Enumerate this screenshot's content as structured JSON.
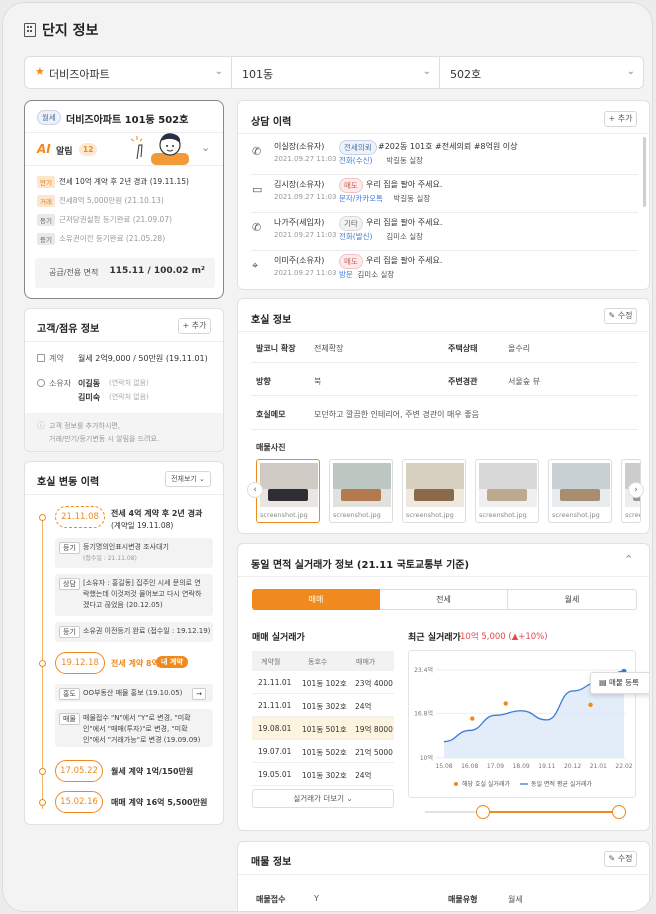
{
  "title": "단지 정보",
  "selects": {
    "apt": "더비즈아파트",
    "dong": "101동",
    "ho": "502호"
  },
  "unit_card": {
    "badge": "월세",
    "name": "더비즈아파트 101동 502호",
    "ai_label": "알림",
    "ai_count": "12",
    "alerts": [
      {
        "tag": "만기",
        "text": "전세 10억 계약 후 2년 경과 (19.11.15)"
      },
      {
        "tag": "거래",
        "text": "전세8억 5,000만원 (21.10.13)"
      },
      {
        "tag": "등기",
        "text": "근저당권설정 등기완료 (21.09.07)"
      },
      {
        "tag": "등기",
        "text": "소유권이전 등기완료 (21.05.28)"
      }
    ],
    "area_label": "공급/전용 면적",
    "area_value": "115.11 / 100.02 m²"
  },
  "customer": {
    "title": "고객/점유 정보",
    "add": "+ 추가",
    "contract_label": "계약",
    "contract_value": "월세 2억9,000 / 50만원 (19.11.01)",
    "owner_label": "소유자",
    "owners": [
      {
        "name": "이길동",
        "note": "(연락처 없음)"
      },
      {
        "name": "김미숙",
        "note": "(연락처 없음)"
      }
    ],
    "hint1": "고객 정보를 추가하시면,",
    "hint2": "거래/만기/등기변동 시 알림을 드려요."
  },
  "history": {
    "title": "호실 변동 이력",
    "filter": "전체보기",
    "events": [
      {
        "date": "21.11.08",
        "text": "전세 4억 계약 후 2년 경과",
        "sub": "(계약일 19.11.08)"
      },
      {
        "date": "19.12.18",
        "text": "전세 계약 8억",
        "badge": "내 계약"
      },
      {
        "date": "17.05.22",
        "text": "월세 계약 1억/150만원"
      },
      {
        "date": "15.02.16",
        "text": "매매 계약 16억 5,500만원"
      }
    ],
    "notes": [
      {
        "tag": "등기",
        "lines": [
          "등기명의인표시변경 조사대기",
          "(접수일 : 21.11.08)"
        ]
      },
      {
        "tag": "상담",
        "lines": [
          "[소유자 : 홍길동] 집주인 시세 문의로 연",
          "락했는데 이것저것 물어보고 다시 연락하",
          "겠다고 끊었음 (20.12.05)"
        ]
      },
      {
        "tag": "등기",
        "lines": [
          "소유권 이전등기 완료 (접수일 : 19.12.19)"
        ]
      },
      {
        "tag": "홍도",
        "lines": [
          "OO부동산 매물 홍보 (19.10.05)"
        ]
      },
      {
        "tag": "매물",
        "lines": [
          "매물접수 \"N\"에서 \"Y\"로 변경, \"미확",
          "인\"에서 \"매매(투자)\"로 변경, \"미확",
          "인\"에서 \"거래가능\"로 변경 (19.09.09)"
        ]
      }
    ]
  },
  "consult": {
    "title": "상담 이력",
    "add": "+ 추가",
    "items": [
      {
        "icon": "phone-in-icon",
        "who": "이실장(소유자)",
        "tag": "전세의뢰",
        "content": "#202동 101호 #전세의뢰 #8억원 이상",
        "time": "2021.09.27 11:03",
        "channel": "전화(수신)",
        "agent": "박길동 실장"
      },
      {
        "icon": "chat-icon",
        "who": "김시장(소유자)",
        "tag": "매도",
        "content": "우리 집을 팔아 주세요.",
        "time": "2021.09.27 11:03",
        "channel": "문자/카카오톡",
        "agent": "박길동 실장"
      },
      {
        "icon": "phone-out-icon",
        "who": "나가주(세입자)",
        "tag": "기타",
        "content": "우리 집을 팔아 주세요.",
        "time": "2021.09.27 11:03",
        "channel": "전화(발신)",
        "agent": "김미소 실장"
      },
      {
        "icon": "pin-icon",
        "who": "이미주(소유자)",
        "tag": "매도",
        "content": "우리 집을 팔아 주세요.",
        "time": "2021.09.27 11:03",
        "channel": "방문",
        "agent": "김미소 실장"
      }
    ]
  },
  "room": {
    "title": "호실 정보",
    "edit": "수정",
    "balcony_label": "발코니 확장",
    "balcony": "전체확장",
    "status_label": "주택상태",
    "status": "올수리",
    "dir_label": "방향",
    "dir": "북",
    "view_label": "주변경관",
    "view": "서울숲 뷰",
    "memo_label": "호실메모",
    "memo": "모던하고 깔끔한 인테리어, 주변 경관이 매우 좋음",
    "photos_label": "매물사진",
    "photo_caption": "screenshot.jpg"
  },
  "trade": {
    "title": "동일 면적 실거래가 정보 (21.11 국토교통부 기준)",
    "tabs": [
      "매매",
      "전세",
      "월세"
    ],
    "list_title": "매매 실거래가",
    "cols": [
      "계약월",
      "동호수",
      "매매가"
    ],
    "rows": [
      [
        "21.11.01",
        "101동 102호",
        "23억 4000"
      ],
      [
        "21.11.01",
        "101동 302호",
        "24억"
      ],
      [
        "19.08.01",
        "101동 501호",
        "19억 8000"
      ],
      [
        "19.07.01",
        "101동 502호",
        "21억 5000"
      ],
      [
        "19.05.01",
        "101동 302호",
        "24억"
      ]
    ],
    "more": "실거래가 더보기",
    "recent_label": "최근 실거래가",
    "recent_value": "10억 5,000 (▲+10%)",
    "popup": "매물 등록",
    "legend1": "해당 호실 실거래가",
    "legend2": "동일 면적 평균 실거래가"
  },
  "chart_data": {
    "type": "line",
    "x": [
      "15.08",
      "16.08",
      "17.09",
      "18.09",
      "19.11",
      "20.12",
      "21.01",
      "22.02"
    ],
    "yticks": [
      "10억",
      "16.8억",
      "23.4억"
    ],
    "ylim": [
      10,
      23.4
    ],
    "series": [
      {
        "name": "동일 면적 평균 실거래가",
        "values": [
          12.5,
          14.2,
          16.5,
          17.2,
          15.8,
          20.2,
          21.5,
          23.2
        ]
      },
      {
        "name": "해당 호실 실거래가",
        "points": [
          [
            1.1,
            16.0
          ],
          [
            2.4,
            18.3
          ],
          [
            5.7,
            18.1
          ],
          [
            6.8,
            21.0
          ]
        ]
      }
    ]
  },
  "listing": {
    "title": "매물 정보",
    "edit": "수정",
    "recv_label": "매물접수",
    "recv": "Y",
    "type_label": "매물유형",
    "type": "월세"
  }
}
